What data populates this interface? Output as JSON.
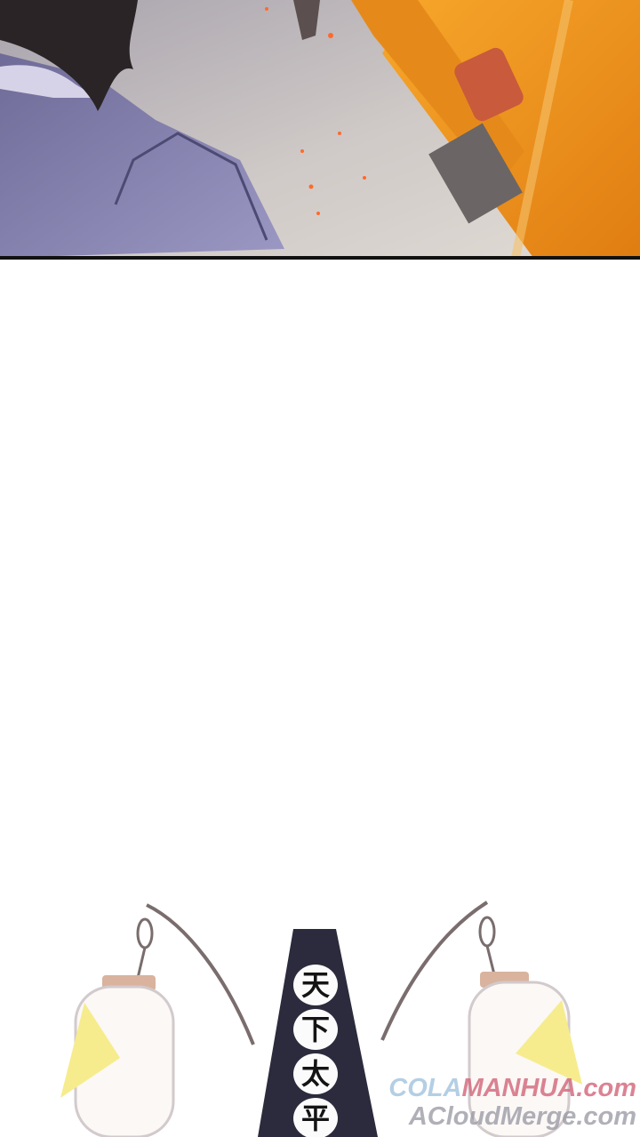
{
  "banner": {
    "chars": [
      "天",
      "下",
      "太",
      "平"
    ]
  },
  "watermark": {
    "line1_cola": "COLA",
    "line1_rest": "MANHUA.com",
    "line2": "ACloudMerge.com"
  },
  "colors": {
    "sky": "#ffffff",
    "robe": "#7b77a6",
    "fire_orange": "#f39b1e",
    "banner_dark": "#2b2b3d",
    "lantern_accent": "#f6ec8d"
  }
}
